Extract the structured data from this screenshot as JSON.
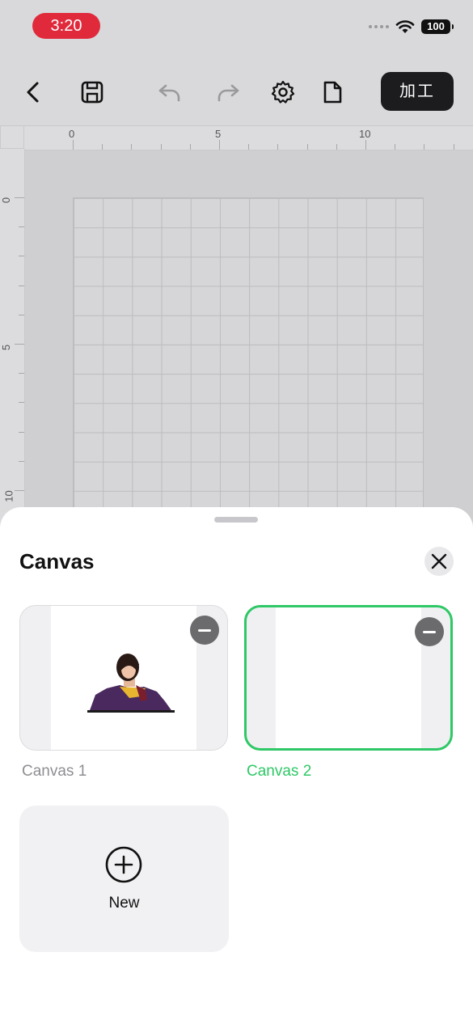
{
  "status_bar": {
    "time": "3:20",
    "battery": "100"
  },
  "toolbar": {
    "process_label": "加工",
    "icons": [
      "back-icon",
      "save-icon",
      "undo-icon",
      "redo-icon",
      "settings-icon",
      "document-icon"
    ]
  },
  "ruler": {
    "top_labels": [
      "0",
      "5",
      "10"
    ],
    "left_labels": [
      "0",
      "5",
      "10"
    ]
  },
  "sheet": {
    "title": "Canvas",
    "canvases": [
      {
        "label": "Canvas 1",
        "selected": false
      },
      {
        "label": "Canvas 2",
        "selected": true
      }
    ],
    "new_label": "New"
  },
  "colors": {
    "accent": "#2ec866",
    "time_pill": "#e02a3c",
    "dark_button": "#1c1c1e"
  }
}
